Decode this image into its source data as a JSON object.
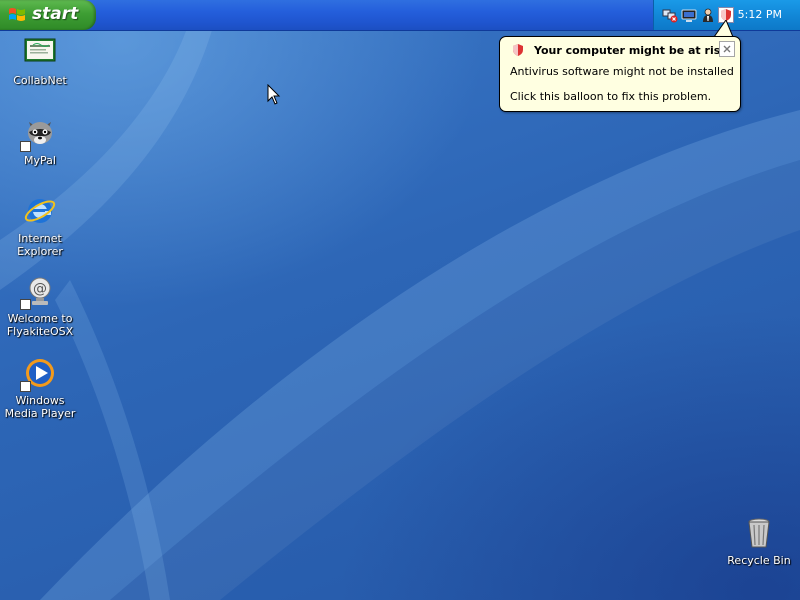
{
  "taskbar": {
    "start_label": "start",
    "clock": "5:12 PM",
    "tray_icons": [
      "network-warning-icon",
      "monitor-icon",
      "user-icon",
      "security-shield-icon"
    ]
  },
  "desktop_icons": [
    {
      "label": "CollabNet",
      "icon": "certificate-icon"
    },
    {
      "label": "MyPal",
      "icon": "raccoon-icon"
    },
    {
      "label": "Internet Explorer",
      "icon": "internet-explorer-icon"
    },
    {
      "label": "Welcome to FlyakiteOSX",
      "icon": "at-sign-icon"
    },
    {
      "label": "Windows Media Player",
      "icon": "media-player-icon"
    },
    {
      "label": "Recycle Bin",
      "icon": "recycle-bin-icon"
    }
  ],
  "balloon": {
    "title": "Your computer might be at risk",
    "line1": "Antivirus software might not be installed",
    "line2": "Click this balloon to fix this problem.",
    "close_symbol": "×"
  },
  "colors": {
    "desktop": "#2f66b5",
    "taskbar": "#245edb",
    "start_button": "#3e9e34",
    "tray": "#1288d8",
    "balloon_bg": "#ffffe1"
  }
}
